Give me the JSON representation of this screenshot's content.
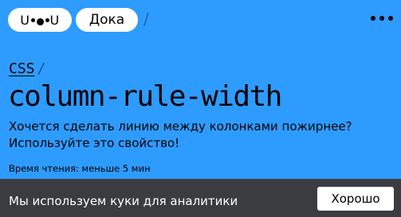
{
  "header": {
    "logo_text_left": "U",
    "logo_text_right": "U",
    "site_name": "Дока",
    "separator": "/"
  },
  "breadcrumb": {
    "section": "CSS",
    "separator": "/"
  },
  "article": {
    "title": "column-rule-width",
    "lead_line1": "Хочется сделать линию между колонками пожирнее?",
    "lead_line2": "Используйте это свойство!",
    "reading_time": "Время чтения: меньше 5 мин"
  },
  "cookie": {
    "text": "Мы используем куки для аналитики",
    "button_label": "Хорошо"
  },
  "colors": {
    "background": "#2e9bff",
    "cookie_bar": "#3b3c40"
  }
}
